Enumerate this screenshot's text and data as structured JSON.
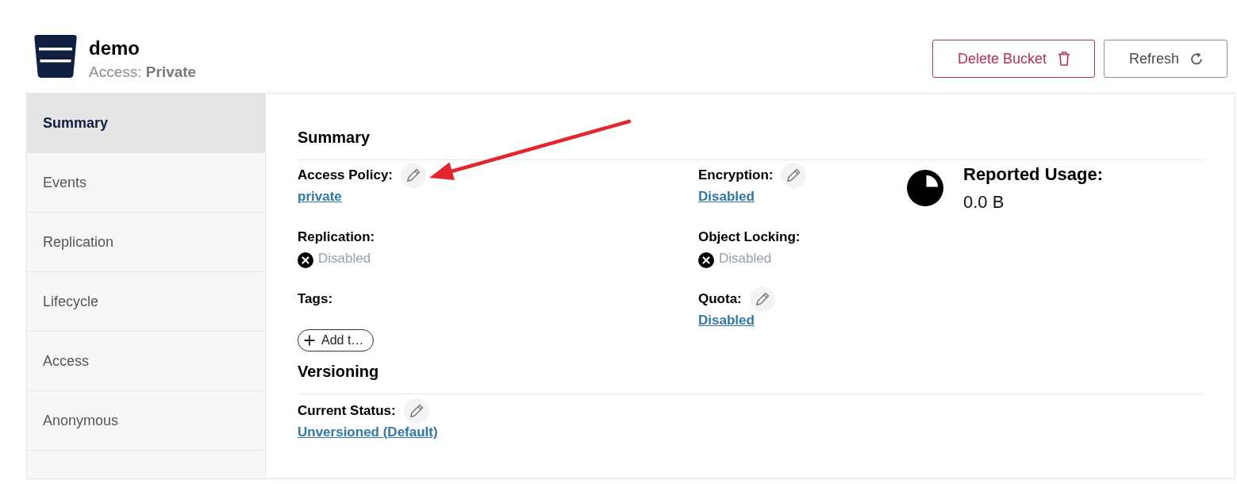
{
  "header": {
    "title": "demo",
    "subtitle": "Access: **Private**",
    "actions": [
      {
        "label": "Delete Bucket",
        "kind": "delete"
      },
      {
        "label": "Refresh",
        "kind": "refresh"
      }
    ]
  },
  "sidebar": {
    "items": [
      {
        "label": "Summary",
        "selected": true
      },
      {
        "label": "Events",
        "selected": false
      },
      {
        "label": "Replication",
        "selected": false
      },
      {
        "label": "Lifecycle",
        "selected": false
      },
      {
        "label": "Access",
        "selected": false
      },
      {
        "label": "Anonymous",
        "selected": false
      }
    ]
  },
  "summary": {
    "title": "Summary",
    "fields": [
      {
        "label": "Access Policy:",
        "kind": "link",
        "value": "private",
        "editable": true
      },
      {
        "label": "Encryption:",
        "kind": "link",
        "value": "Disabled",
        "editable": true
      },
      {
        "label": "Replication:",
        "kind": "status",
        "value": "Disabled",
        "editable": false
      },
      {
        "label": "Object Locking:",
        "kind": "status",
        "value": "Disabled",
        "editable": false
      },
      {
        "label": "Tags:",
        "kind": "tags",
        "add_label": "Add t…",
        "editable": false
      },
      {
        "label": "Quota:",
        "kind": "link",
        "value": "Disabled",
        "editable": true
      }
    ],
    "usage": {
      "label": "Reported Usage:",
      "value": "0.0 B"
    }
  },
  "versioning": {
    "title": "Versioning",
    "fields": [
      {
        "label": "Current Status:",
        "kind": "link",
        "value": "Unversioned (Default)",
        "editable": true
      }
    ]
  }
}
